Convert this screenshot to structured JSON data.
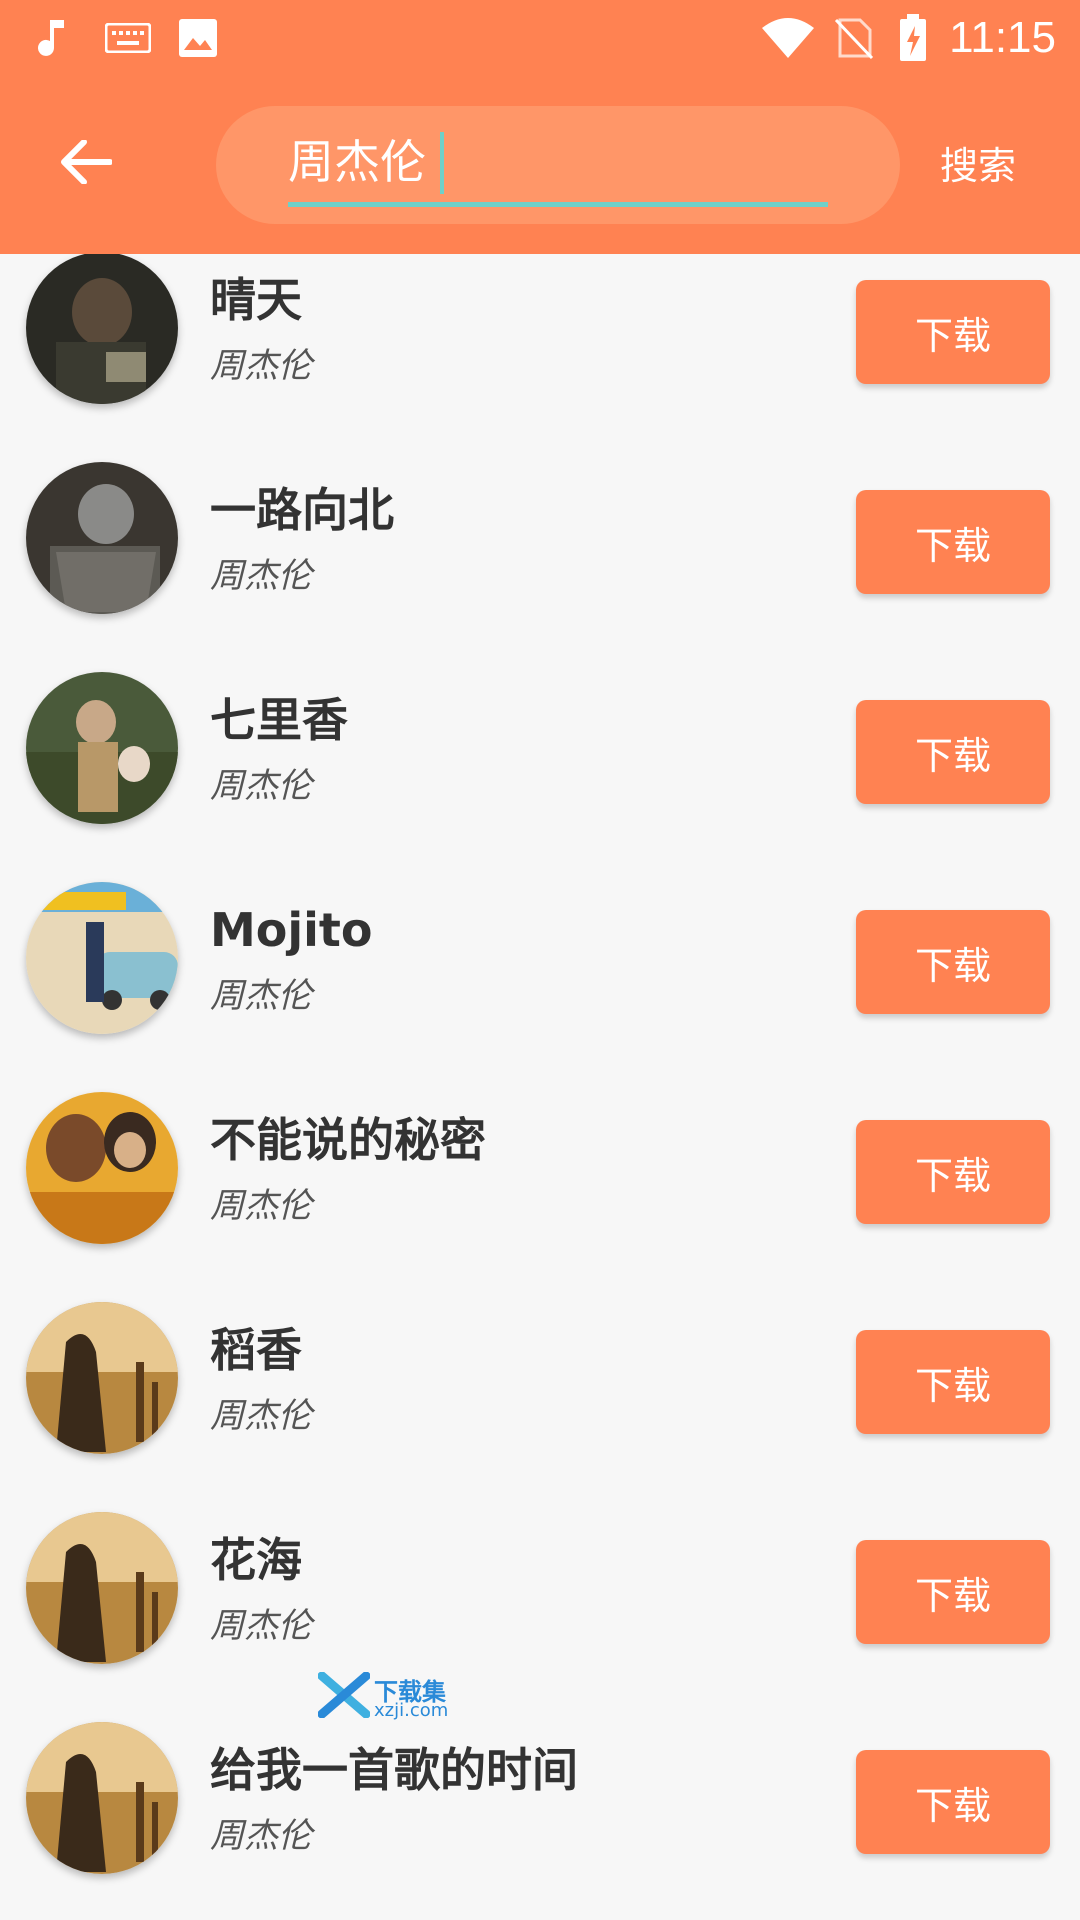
{
  "status_bar": {
    "time": "11:15",
    "icons": [
      "music-note-icon",
      "keyboard-icon",
      "image-icon",
      "wifi-icon",
      "no-sim-icon",
      "battery-charging-icon"
    ]
  },
  "header": {
    "back_icon": "arrow-left-icon",
    "search": {
      "value": "周杰伦",
      "placeholder": ""
    },
    "search_action_label": "搜索"
  },
  "colors": {
    "accent": "#ff8252",
    "search_box": "#ff9668",
    "underline": "#6fd0c8",
    "background": "#f7f7f7"
  },
  "songs": [
    {
      "title": "晴天",
      "artist": "周杰伦",
      "action_label": "下载"
    },
    {
      "title": "一路向北",
      "artist": "周杰伦",
      "action_label": "下载"
    },
    {
      "title": "七里香",
      "artist": "周杰伦",
      "action_label": "下载"
    },
    {
      "title": "Mojito",
      "artist": "周杰伦",
      "action_label": "下载"
    },
    {
      "title": "不能说的秘密",
      "artist": "周杰伦",
      "action_label": "下载"
    },
    {
      "title": "稻香",
      "artist": "周杰伦",
      "action_label": "下载"
    },
    {
      "title": "花海",
      "artist": "周杰伦",
      "action_label": "下载"
    },
    {
      "title": "给我一首歌的时间",
      "artist": "周杰伦",
      "action_label": "下载"
    }
  ],
  "watermark": {
    "line1": "下载集",
    "line2": "xzji.com"
  }
}
